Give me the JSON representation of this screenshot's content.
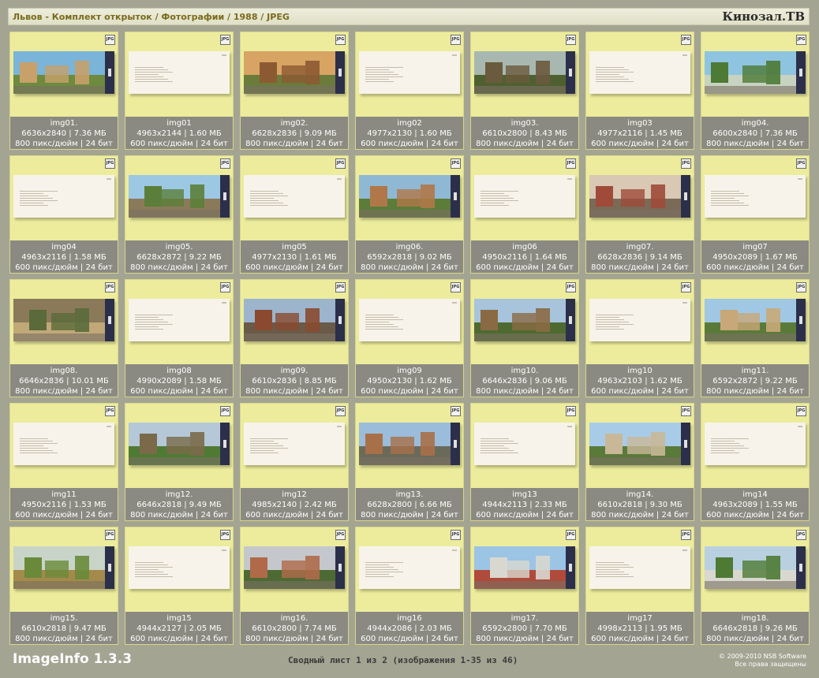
{
  "header": {
    "path": "Львов - Комплект открыток / Фотографии / 1988 / JPEG",
    "brand": "Кинозал.ТВ"
  },
  "icon_label": "JPG",
  "thumbnails": [
    {
      "name": "img01.",
      "line1": "6636x2840 | 7.36 МБ",
      "line2": "800 пикс/дюйм | 24 бит",
      "kind": "photo",
      "colors": [
        "#7ab4d8",
        "#c7a06a",
        "#6d8a3e"
      ]
    },
    {
      "name": "img01",
      "line1": "4963x2144 | 1.60 МБ",
      "line2": "600 пикс/дюйм | 24 бит",
      "kind": "text"
    },
    {
      "name": "img02.",
      "line1": "6628x2836 | 9.09 МБ",
      "line2": "800 пикс/дюйм | 24 бит",
      "kind": "photo",
      "colors": [
        "#d7a464",
        "#8c5a32",
        "#6a7b3c"
      ]
    },
    {
      "name": "img02",
      "line1": "4977x2130 | 1.60 МБ",
      "line2": "600 пикс/дюйм | 24 бит",
      "kind": "text"
    },
    {
      "name": "img03.",
      "line1": "6610x2800 | 8.43 МБ",
      "line2": "800 пикс/дюйм | 24 бит",
      "kind": "photo",
      "colors": [
        "#a8b8b0",
        "#6a5a3e",
        "#4f6030"
      ]
    },
    {
      "name": "img03",
      "line1": "4977x2116 | 1.45 МБ",
      "line2": "600 пикс/дюйм | 24 бит",
      "kind": "text"
    },
    {
      "name": "img04.",
      "line1": "6600x2840 | 7.36 МБ",
      "line2": "800 пикс/дюйм | 24 бит",
      "kind": "photo",
      "colors": [
        "#8ec4e0",
        "#4d7a34",
        "#c8d2c0"
      ]
    },
    {
      "name": "img04",
      "line1": "4963x2116 | 1.58 МБ",
      "line2": "600 пикс/дюйм | 24 бит",
      "kind": "text"
    },
    {
      "name": "img05.",
      "line1": "6628x2872 | 9.22 МБ",
      "line2": "800 пикс/дюйм | 24 бит",
      "kind": "photo",
      "colors": [
        "#9cc8e4",
        "#5b7f3a",
        "#8b7a5a"
      ]
    },
    {
      "name": "img05",
      "line1": "4977x2130 | 1.61 МБ",
      "line2": "600 пикс/дюйм | 24 бит",
      "kind": "text"
    },
    {
      "name": "img06.",
      "line1": "6592x2818 | 9.02 МБ",
      "line2": "800 пикс/дюйм | 24 бит",
      "kind": "photo",
      "colors": [
        "#8fb8d4",
        "#b07848",
        "#5c7c3a"
      ]
    },
    {
      "name": "img06",
      "line1": "4950x2116 | 1.64 МБ",
      "line2": "600 пикс/дюйм | 24 бит",
      "kind": "text"
    },
    {
      "name": "img07.",
      "line1": "6628x2836 | 9.14 МБ",
      "line2": "800 пикс/дюйм | 24 бит",
      "kind": "photo",
      "colors": [
        "#d8c8b4",
        "#a04a3a",
        "#7a6a58"
      ]
    },
    {
      "name": "img07",
      "line1": "4950x2089 | 1.67 МБ",
      "line2": "600 пикс/дюйм | 24 бит",
      "kind": "text"
    },
    {
      "name": "img08.",
      "line1": "6646x2836 | 10.01 МБ",
      "line2": "800 пикс/дюйм | 24 бит",
      "kind": "photo",
      "colors": [
        "#8a7a5a",
        "#5a6a3a",
        "#c0a878"
      ]
    },
    {
      "name": "img08",
      "line1": "4990x2089 | 1.58 МБ",
      "line2": "600 пикс/дюйм | 24 бит",
      "kind": "text"
    },
    {
      "name": "img09.",
      "line1": "6610x2836 | 8.85 МБ",
      "line2": "800 пикс/дюйм | 24 бит",
      "kind": "photo",
      "colors": [
        "#9cb4cc",
        "#8a4a30",
        "#6a5a48"
      ]
    },
    {
      "name": "img09",
      "line1": "4950x2130 | 1.62 МБ",
      "line2": "600 пикс/дюйм | 24 бит",
      "kind": "text"
    },
    {
      "name": "img10.",
      "line1": "6646x2836 | 9.06 МБ",
      "line2": "800 пикс/дюйм | 24 бит",
      "kind": "photo",
      "colors": [
        "#a8c4dc",
        "#8a6a44",
        "#4e6a30"
      ]
    },
    {
      "name": "img10",
      "line1": "4963x2103 | 1.62 МБ",
      "line2": "600 пикс/дюйм | 24 бит",
      "kind": "text"
    },
    {
      "name": "img11.",
      "line1": "6592x2872 | 9.22 МБ",
      "line2": "800 пикс/дюйм | 24 бит",
      "kind": "photo",
      "colors": [
        "#a0c8e4",
        "#c8a878",
        "#5a7a3a"
      ]
    },
    {
      "name": "img11",
      "line1": "4950x2116 | 1.53 МБ",
      "line2": "600 пикс/дюйм | 24 бит",
      "kind": "text"
    },
    {
      "name": "img12.",
      "line1": "6646x2818 | 9.49 МБ",
      "line2": "800 пикс/дюйм | 24 бит",
      "kind": "photo",
      "colors": [
        "#b4c8d8",
        "#7a6a4a",
        "#4f7a34"
      ]
    },
    {
      "name": "img12",
      "line1": "4985x2140 | 2.42 МБ",
      "line2": "600 пикс/дюйм | 24 бит",
      "kind": "text"
    },
    {
      "name": "img13.",
      "line1": "6628x2800 | 6.66 МБ",
      "line2": "800 пикс/дюйм | 24 бит",
      "kind": "photo",
      "colors": [
        "#9cbcdc",
        "#a87048",
        "#6a6a5a"
      ]
    },
    {
      "name": "img13",
      "line1": "4944x2113 | 2.33 МБ",
      "line2": "600 пикс/дюйм | 24 бит",
      "kind": "text"
    },
    {
      "name": "img14.",
      "line1": "6610x2818 | 9.30 МБ",
      "line2": "800 пикс/дюйм | 24 бит",
      "kind": "photo",
      "colors": [
        "#a8cce8",
        "#c8b898",
        "#5a7a3a"
      ]
    },
    {
      "name": "img14",
      "line1": "4963x2089 | 1.55 МБ",
      "line2": "600 пикс/дюйм | 24 бит",
      "kind": "text"
    },
    {
      "name": "img15.",
      "line1": "6610x2818 | 9.47 МБ",
      "line2": "800 пикс/дюйм | 24 бит",
      "kind": "photo",
      "colors": [
        "#c8d4c8",
        "#6a8a3a",
        "#a48a4a"
      ]
    },
    {
      "name": "img15",
      "line1": "4944x2127 | 2.05 МБ",
      "line2": "600 пикс/дюйм | 24 бит",
      "kind": "text"
    },
    {
      "name": "img16.",
      "line1": "6610x2800 | 7.74 МБ",
      "line2": "800 пикс/дюйм | 24 бит",
      "kind": "photo",
      "colors": [
        "#c4c8cc",
        "#b06a4a",
        "#4e6a34"
      ]
    },
    {
      "name": "img16",
      "line1": "4944x2086 | 2.03 МБ",
      "line2": "600 пикс/дюйм | 24 бит",
      "kind": "text"
    },
    {
      "name": "img17.",
      "line1": "6592x2800 | 7.70 МБ",
      "line2": "800 пикс/дюйм | 24 бит",
      "kind": "photo",
      "colors": [
        "#9cc4e4",
        "#d8d8d0",
        "#b04a3a"
      ]
    },
    {
      "name": "img17",
      "line1": "4998x2113 | 1.95 МБ",
      "line2": "600 пикс/дюйм | 24 бит",
      "kind": "text"
    },
    {
      "name": "img18.",
      "line1": "6646x2818 | 9.26 МБ",
      "line2": "800 пикс/дюйм | 24 бит",
      "kind": "photo",
      "colors": [
        "#b8d0e0",
        "#4e7a34",
        "#d8d8d0"
      ]
    }
  ],
  "footer": {
    "app_name": "ImageInfo 1.3.3",
    "summary": "Сводный лист 1 из 2 (изображения 1-35 из 46)",
    "copyright": "© 2009-2010 NSB Software",
    "rights": "Все права защищены"
  },
  "colors": {
    "background": "#a4a493",
    "cell": "#ecec9c",
    "info_bar": "#8a8a82",
    "card_dark": "#2c2f4a"
  }
}
